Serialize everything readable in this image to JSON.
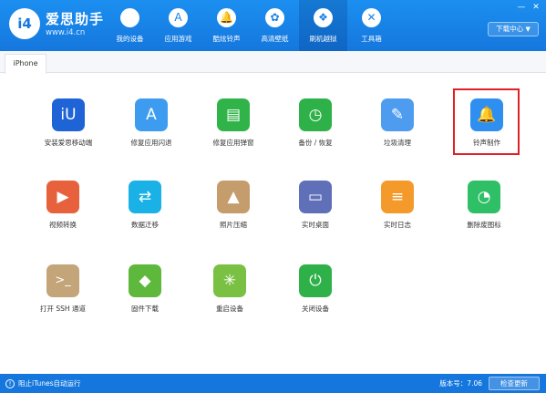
{
  "brand": {
    "logo_text": "i4",
    "name": "爱思助手",
    "url": "www.i4.cn"
  },
  "nav": [
    {
      "label": "我的设备",
      "icon": ""
    },
    {
      "label": "应用游戏",
      "icon": "A"
    },
    {
      "label": "酷炫铃声",
      "icon": "🔔"
    },
    {
      "label": "高清壁纸",
      "icon": "✿"
    },
    {
      "label": "刷机越狱",
      "icon": "❖"
    },
    {
      "label": "工具箱",
      "icon": "✕"
    }
  ],
  "window": {
    "minimize": "—",
    "close": "✕"
  },
  "download_center": {
    "label": "下载中心",
    "arrow": "▼"
  },
  "tab": {
    "label": "iPhone"
  },
  "apps": [
    {
      "label": "安装爱思移动端",
      "icon": "iU",
      "color": "#1f64d6"
    },
    {
      "label": "修复应用闪退",
      "icon": "A",
      "color": "#3d9cf0"
    },
    {
      "label": "修复应用弹窗",
      "icon": "▤",
      "color": "#30b44a"
    },
    {
      "label": "备份 / 恢复",
      "icon": "◷",
      "color": "#2fb14a"
    },
    {
      "label": "垃圾清理",
      "icon": "✎",
      "color": "#4d9cf0"
    },
    {
      "label": "铃声制作",
      "icon": "🔔",
      "color": "#2f8ff0"
    },
    {
      "label": "视频转换",
      "icon": "▶",
      "color": "#e8613d"
    },
    {
      "label": "数据迁移",
      "icon": "⇄",
      "color": "#1ab1e6"
    },
    {
      "label": "照片压缩",
      "icon": "▲",
      "color": "#c59c6b"
    },
    {
      "label": "实时桌面",
      "icon": "▭",
      "color": "#5f6fb8"
    },
    {
      "label": "实时日志",
      "icon": "≡",
      "color": "#f39a2a"
    },
    {
      "label": "删除废图标",
      "icon": "◔",
      "color": "#2ebf67"
    },
    {
      "label": "打开 SSH 通道",
      "icon": ">_",
      "color": "#c4a479"
    },
    {
      "label": "固件下载",
      "icon": "◆",
      "color": "#5eb83b"
    },
    {
      "label": "重启设备",
      "icon": "✳",
      "color": "#7ac143"
    },
    {
      "label": "关闭设备",
      "icon": "⏻",
      "color": "#2fb14a"
    }
  ],
  "footer": {
    "status_icon": "!",
    "status_text": "阻止iTunes自动运行",
    "version": "版本号：7.06",
    "check_update": "检查更新"
  }
}
